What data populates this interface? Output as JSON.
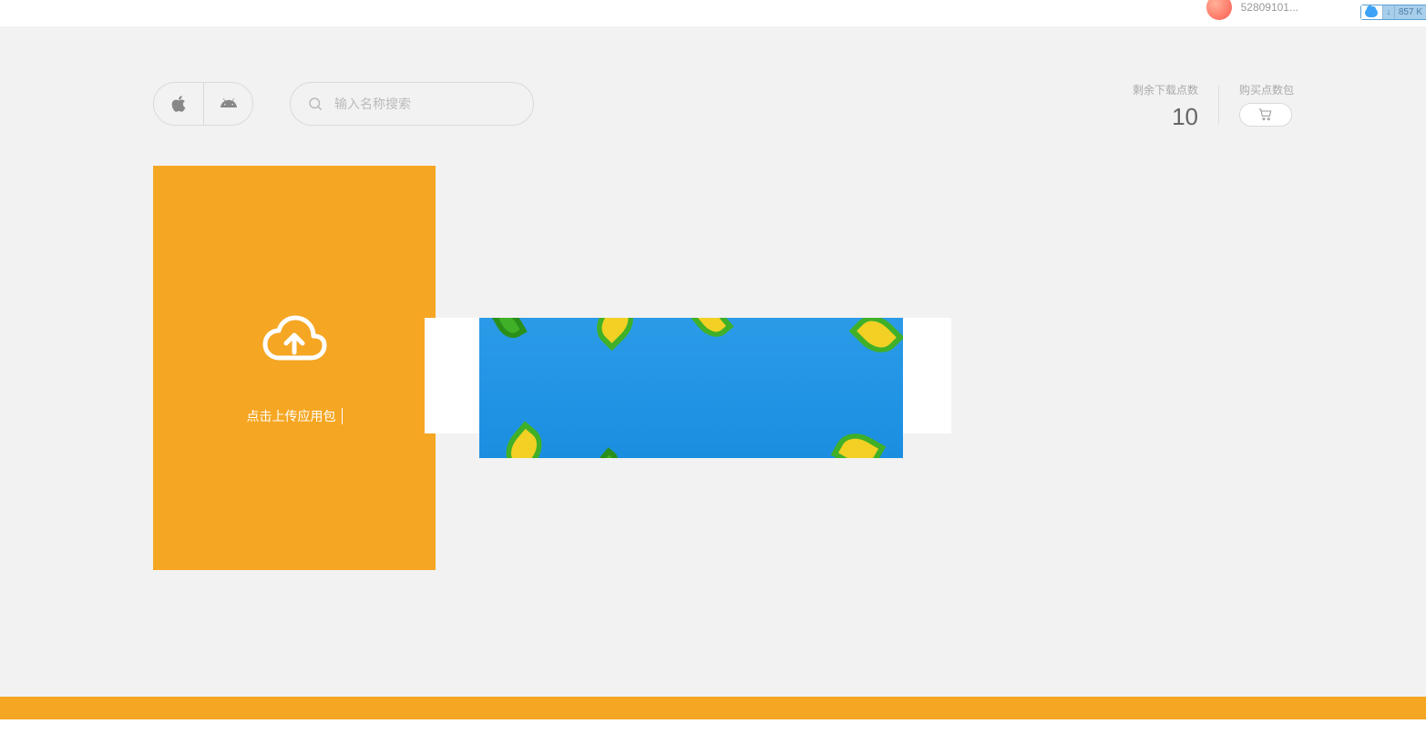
{
  "header": {
    "user_id": "52809101...​"
  },
  "download_widget": {
    "speed": "857 K"
  },
  "toolbar": {
    "search_placeholder": "输入名称搜索"
  },
  "stats": {
    "remaining_label": "剩余下载点数",
    "remaining_value": "10",
    "buy_label": "购买点数包"
  },
  "upload": {
    "text": "点击上传应用包"
  }
}
